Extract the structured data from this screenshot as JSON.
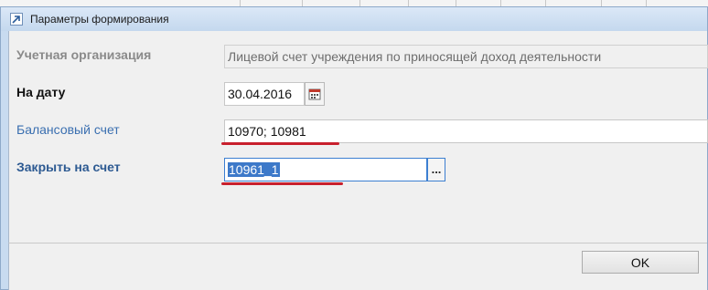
{
  "dialog": {
    "title": "Параметры формирования",
    "ok_label": "OK"
  },
  "fields": {
    "organization": {
      "label": "Учетная организация",
      "value": "Лицевой счет  учреждения по приносящей доход деятельности"
    },
    "date": {
      "label": "На дату",
      "value": "30.04.2016"
    },
    "balance_account": {
      "label": "Балансовый счет",
      "value": "10970; 10981"
    },
    "close_to_account": {
      "label": "Закрыть на счет",
      "value": "10961_1",
      "button_glyph": "..."
    }
  },
  "icons": {
    "title": "dialog-app-icon",
    "date_picker": "calendar-icon",
    "browse": "ellipsis-icon"
  },
  "colors": {
    "accent": "#3a6fb0",
    "selection": "#3d79c9",
    "annotation_underline": "#c8202d"
  }
}
